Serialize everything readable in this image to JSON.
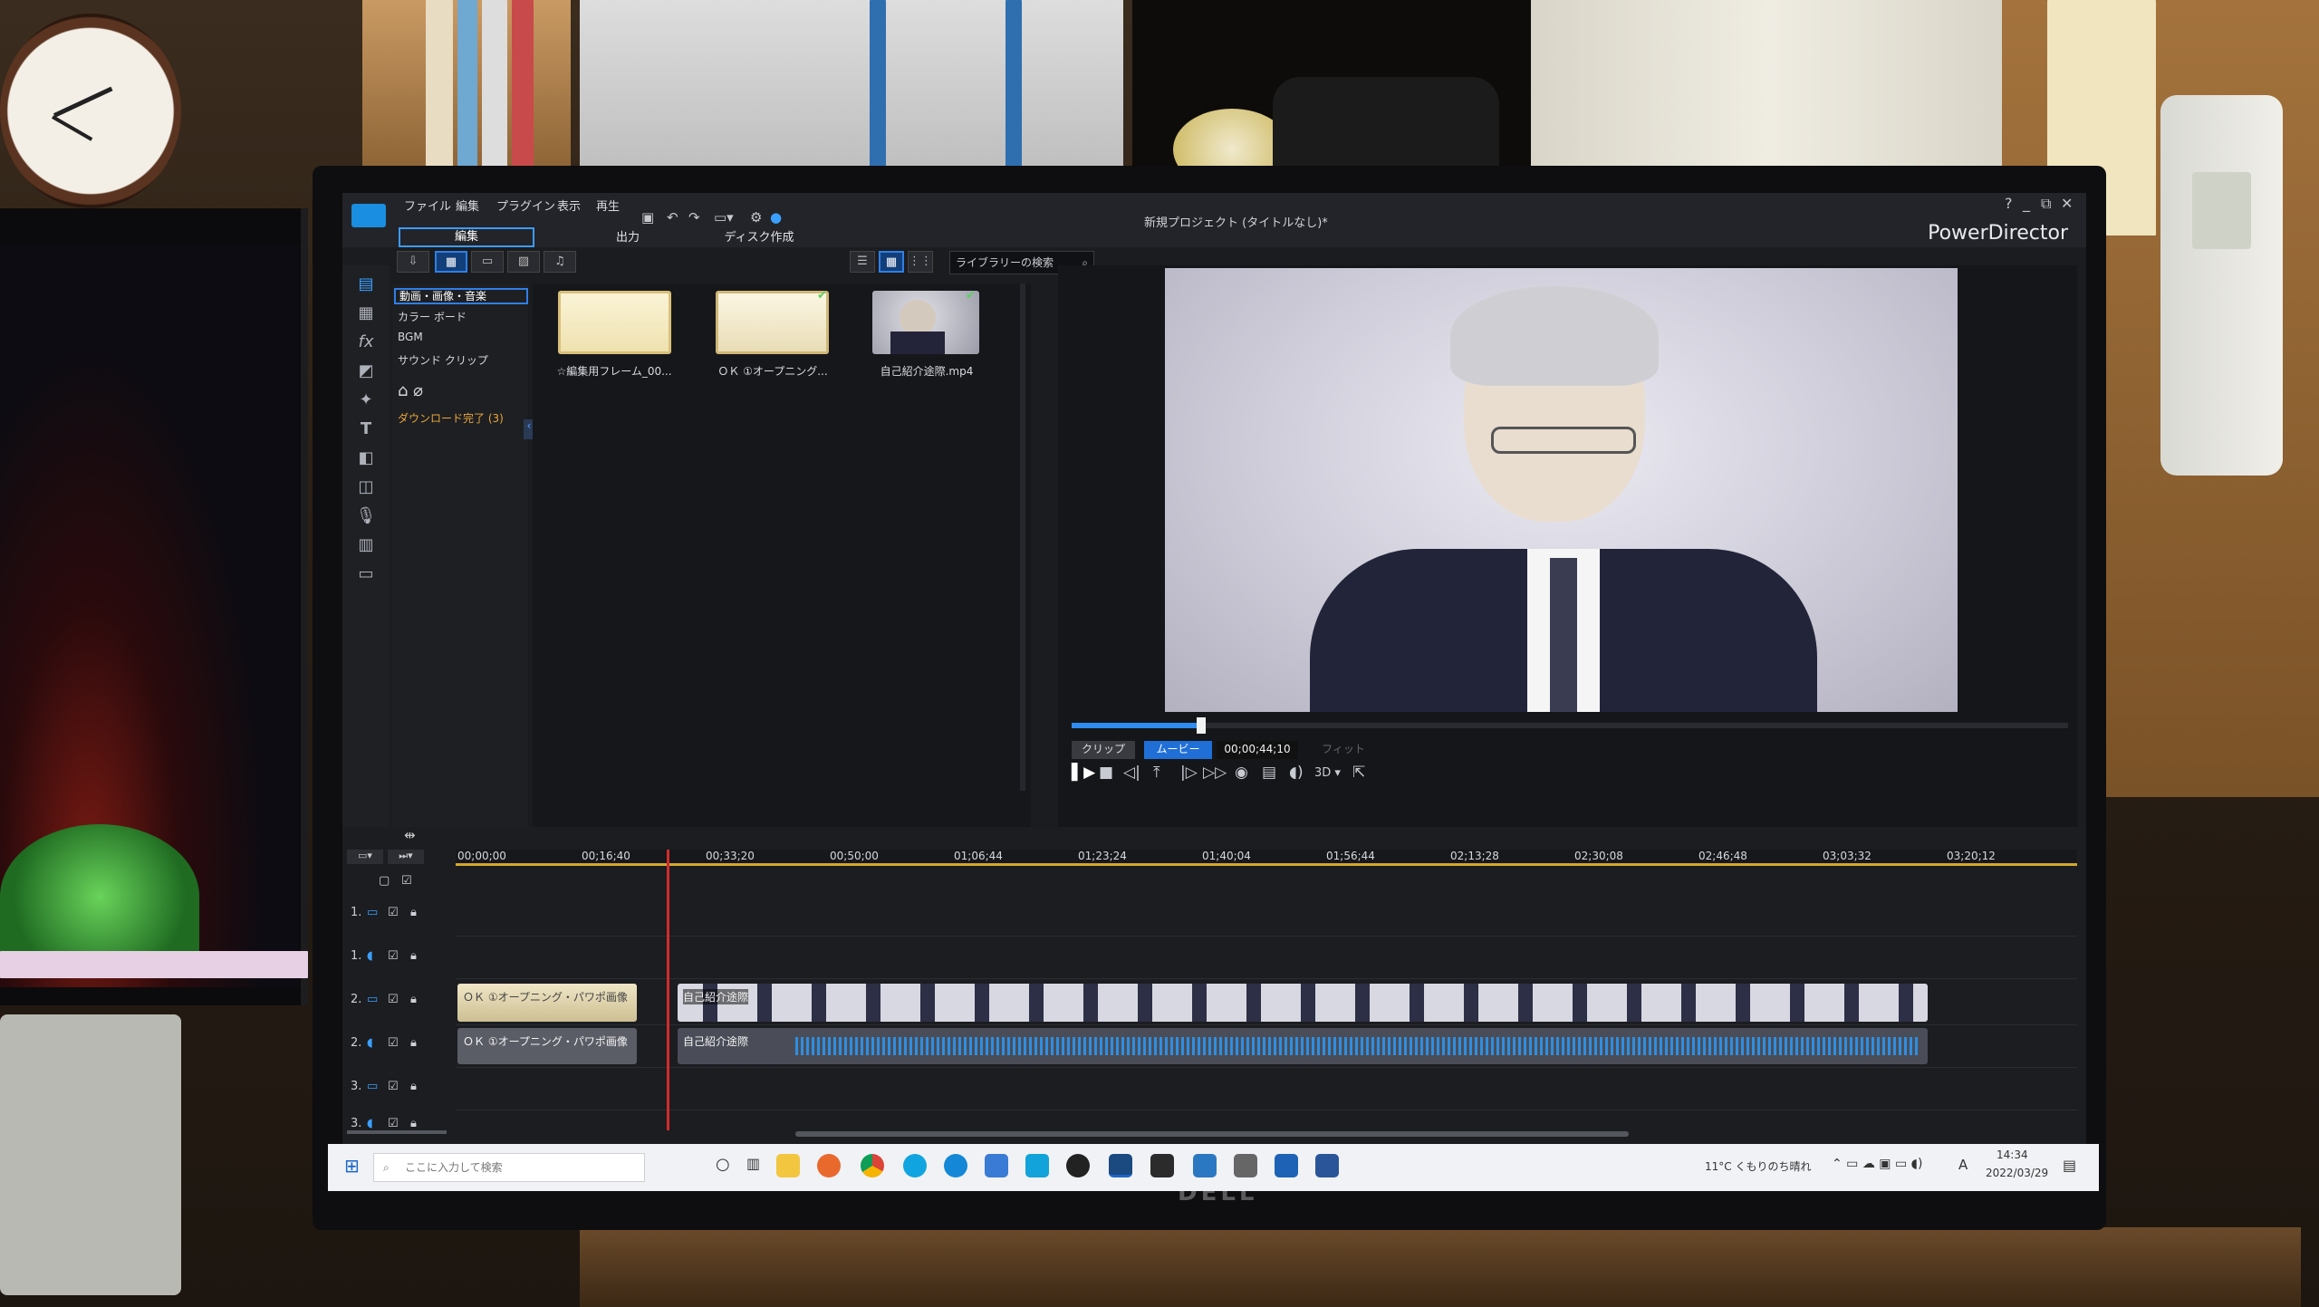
{
  "app": {
    "menu": [
      "ファイル",
      "編集",
      "プラグイン",
      "表示",
      "再生"
    ],
    "modes": {
      "edit": "編集",
      "output": "出力",
      "disc": "ディスク作成"
    },
    "project_title": "新規プロジェクト (タイトルなし)*",
    "brand": "PowerDirector",
    "window_controls": [
      "?",
      "_",
      "⧉",
      "✕"
    ]
  },
  "library": {
    "categories": [
      "動画・画像・音楽",
      "カラー ボード",
      "BGM",
      "サウンド クリップ"
    ],
    "download_status": "ダウンロード完了",
    "download_count": "(3)",
    "search_placeholder": "ライブラリーの検索",
    "items": [
      {
        "label": "☆編集用フレーム_00...",
        "kind": "frame"
      },
      {
        "label": "ＯＫ ①オープニング...",
        "kind": "opening"
      },
      {
        "label": "自己紹介途際.mp4",
        "kind": "video"
      }
    ]
  },
  "preview": {
    "tab_clip": "クリップ",
    "tab_movie": "ムービー",
    "timecode": "00;00;44;10",
    "fit": "フィット",
    "position_fraction": 0.13
  },
  "timeline": {
    "ticks": [
      "00;00;00",
      "00;16;40",
      "00;33;20",
      "00;50;00",
      "01;06;44",
      "01;23;24",
      "01;40;04",
      "01;56;44",
      "02;13;28",
      "02;30;08",
      "02;46;48",
      "03;03;32",
      "03;20;12"
    ],
    "tracks": [
      "1.",
      "1.",
      "2.",
      "2.",
      "3.",
      "3."
    ],
    "clips": {
      "opening_video": "ＯＫ ①オープニング・パワポ画像",
      "opening_audio": "ＯＫ ①オープニング・パワポ画像",
      "main_video": "自己紹介途際",
      "main_audio": "自己紹介途際"
    }
  },
  "taskbar": {
    "search_placeholder": "ここに入力して検索",
    "weather": "11°C くもりのち晴れ",
    "time": "14:34",
    "date": "2022/03/29",
    "ime": "A"
  },
  "monitor_brand": "DELL",
  "colors": {
    "accent": "#2f7fe6",
    "playhead": "#d12c2c",
    "ruler": "#d2a92a",
    "audio_wave": "#2f8ee0"
  }
}
